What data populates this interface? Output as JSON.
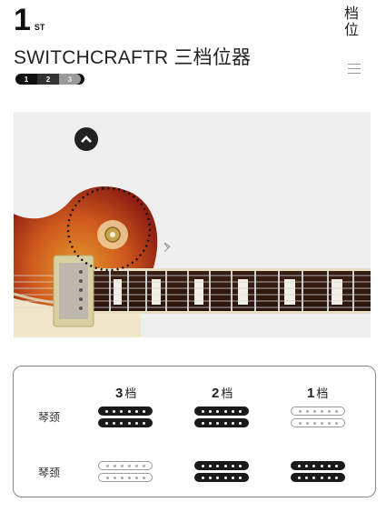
{
  "header": {
    "rank_number": "1",
    "rank_suffix": "ST",
    "side_tab_label": "档位",
    "title": "SWITCHCRAFTR 三档位器"
  },
  "pager": {
    "pages": [
      "1",
      "2",
      "3"
    ],
    "active": 1
  },
  "diagram": {
    "columns": [
      "3",
      "2",
      "1"
    ],
    "column_unit": "档",
    "rows": [
      {
        "label": "琴颈",
        "states": [
          "on",
          "on",
          "off"
        ]
      },
      {
        "label": "琴颈",
        "states": [
          "off",
          "on",
          "on"
        ]
      }
    ]
  }
}
